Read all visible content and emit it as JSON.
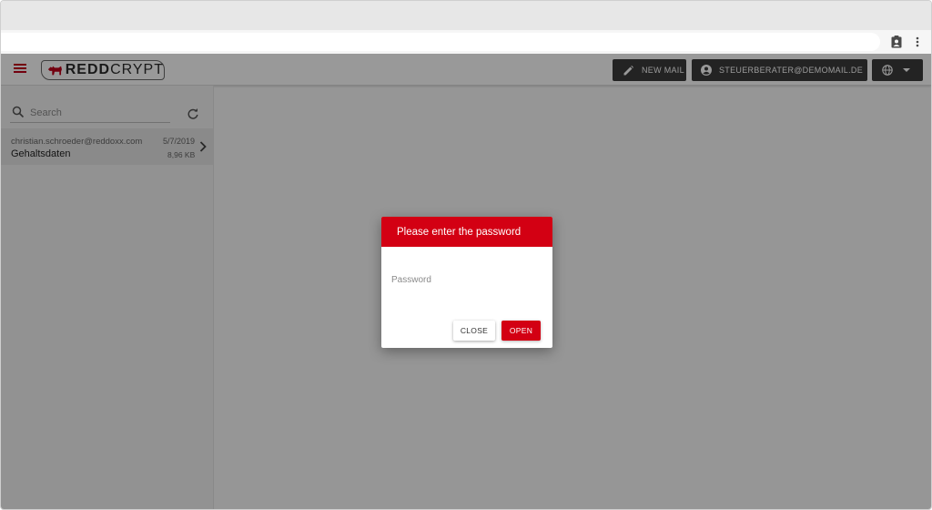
{
  "browser": {
    "icons": [
      "clipboard-user-icon",
      "more-vertical-icon"
    ]
  },
  "app": {
    "brand": {
      "part1": "REDD",
      "part2": "CRYPT"
    },
    "colors": {
      "accent": "#d30013",
      "header_button": "#3b3b3b"
    },
    "header": {
      "new_mail_label": "NEW MAIL",
      "account_label": "STEUERBERATER@DEMOMAIL.DE"
    },
    "search": {
      "placeholder": "Search"
    },
    "mails": [
      {
        "from": "christian.schroeder@reddoxx.com",
        "subject": "Gehaltsdaten",
        "date": "5/7/2019",
        "size": "8,96 KB"
      }
    ]
  },
  "dialog": {
    "title": "Please enter the password",
    "password_placeholder": "Password",
    "close_label": "CLOSE",
    "open_label": "OPEN"
  }
}
